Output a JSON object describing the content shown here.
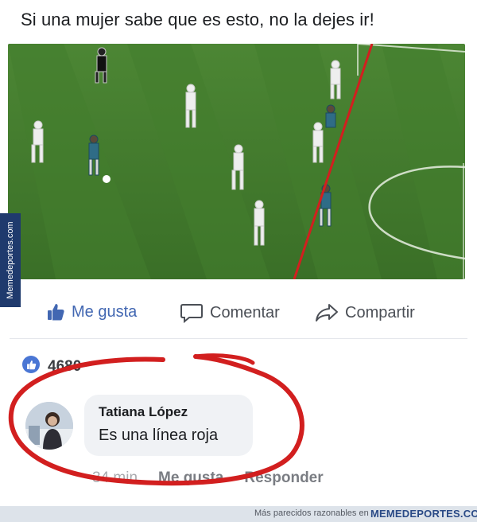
{
  "post": {
    "text": "Si una mujer sabe que es esto, no la dejes ir!"
  },
  "watermark": {
    "text": "Memedeportes.com"
  },
  "actions": {
    "like_label": "Me gusta",
    "comment_label": "Comentar",
    "share_label": "Compartir"
  },
  "reactions": {
    "count": "4680"
  },
  "comment": {
    "author": "Tatiana López",
    "text": "Es una línea roja",
    "time": "34 min",
    "like_label": "Me gusta",
    "reply_label": "Responder"
  },
  "footer": {
    "caption": "Más parecidos razonables en",
    "brand": "MEMEDEPORTES.COM"
  },
  "colors": {
    "facebook_blue": "#4267b2",
    "annotation_red": "#d21f1f",
    "pitch_green": "#3f7a2c",
    "watermark_bg": "#1f3a6d"
  }
}
